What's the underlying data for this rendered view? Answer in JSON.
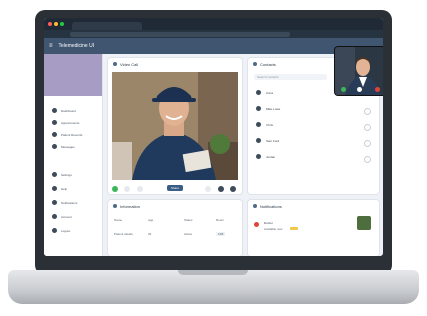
{
  "app": {
    "title": "Telemedicine UI",
    "menu_icon": "menu-icon"
  },
  "colors": {
    "header": "#3f5570",
    "profile_block": "#a79cc4",
    "accent": "#3a5d86",
    "call_green": "#3cb55a",
    "call_red": "#e0443a"
  },
  "sidebar": {
    "items_top": [
      "Dashboard",
      "Appointments",
      "Patient Records",
      "Messages"
    ],
    "items_bottom": [
      "Settings",
      "Help",
      "Notifications",
      "Account",
      "Logout"
    ]
  },
  "video_card": {
    "title": "Video Call",
    "share_label": "Share"
  },
  "contacts_card": {
    "title": "Contacts",
    "search_placeholder": "Search contacts",
    "items": [
      "Anna",
      "Mike Lowe",
      "Chris",
      "Sam Ford",
      "Jordan"
    ]
  },
  "info_card": {
    "title": "Information",
    "labels": [
      "Name",
      "Age",
      "Status",
      "Room"
    ],
    "values": [
      "Patient details",
      "32",
      "Active",
      "12B"
    ]
  },
  "notes_card": {
    "title": "Notifications",
    "item_name": "Doctor",
    "item_sub": "Available now"
  }
}
